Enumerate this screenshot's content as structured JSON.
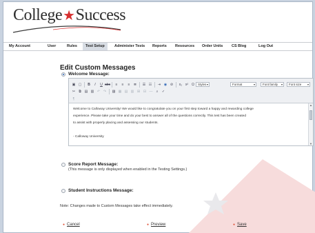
{
  "brand": {
    "name_part1": "College",
    "star": "★",
    "name_part2": "Success",
    "accent": "#d72f2f"
  },
  "nav": {
    "items": [
      {
        "label": "My Account"
      },
      {
        "label": "User"
      },
      {
        "label": "Rules"
      },
      {
        "label": "Test Setup",
        "active": true
      },
      {
        "label": "Administer Tests"
      },
      {
        "label": "Reports"
      },
      {
        "label": "Resources"
      },
      {
        "label": "Order Units"
      },
      {
        "label": "CS Blog"
      },
      {
        "label": "Log Out"
      }
    ]
  },
  "page": {
    "title": "Edit Custom Messages"
  },
  "welcome": {
    "label": "Welcome Message:",
    "selected": true
  },
  "toolbar": {
    "styles": "Styles",
    "format": "Format",
    "font_family": "Font family",
    "font_size": "Font size",
    "icons_row1": [
      "save-icon",
      "new-document-icon",
      "bold-icon",
      "italic-icon",
      "underline-icon",
      "strikethrough-icon",
      "align-left-icon",
      "align-center-icon",
      "align-right-icon",
      "align-justify-icon",
      "bullet-list-icon",
      "numbered-list-icon",
      "indent-icon",
      "outdent-icon",
      "link-icon",
      "unlink-icon",
      "subscript-icon",
      "superscript-icon",
      "special-char-icon"
    ],
    "icons_row2": [
      "cut-icon",
      "copy-icon",
      "paste-icon",
      "paste-text-icon",
      "undo-icon",
      "redo-icon",
      "image-icon",
      "table-icon",
      "row-icon",
      "column-icon",
      "merge-cells-icon",
      "split-cells-icon",
      "horizontal-rule-icon",
      "find-icon",
      "spellcheck-icon"
    ]
  },
  "editor": {
    "line1": "Welcome to Calloway University! We would like to congratulate you on your first step toward a happy and rewarding college",
    "line2": "experience.  Please take your time and do your best to answer all of the questions correctly.  This test has been created",
    "line3": "to assist with properly placing and assessing our students.",
    "signature": "- Calloway University"
  },
  "score_report": {
    "label": "Score Report Message:",
    "note": "(This message is only displayed when enabled in the Testing Settings.)",
    "selected": false
  },
  "instructions": {
    "label": "Student Instructions Message:",
    "selected": false
  },
  "footer": {
    "note": "Note: Changes made to Custom Messages take effect immediately.",
    "cancel": "Cancel",
    "preview": "Preview",
    "save": "Save",
    "bullet": "●"
  }
}
